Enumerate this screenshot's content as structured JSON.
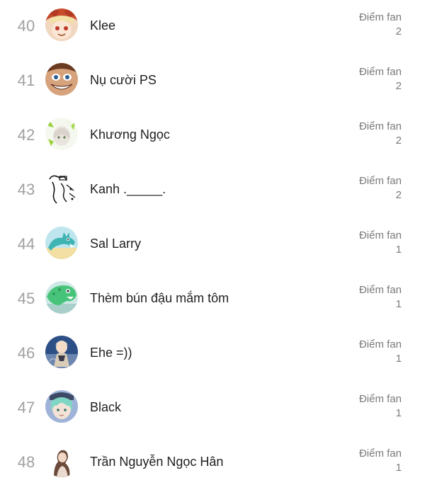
{
  "fans": {
    "score_label": "Điểm fan",
    "items": [
      {
        "rank": "40",
        "name": "Klee",
        "score": "2",
        "avatar": "klee-avatar"
      },
      {
        "rank": "41",
        "name": "Nụ cười PS",
        "score": "2",
        "avatar": "grin-face-avatar"
      },
      {
        "rank": "42",
        "name": "Khương Ngọc",
        "score": "2",
        "avatar": "anime-girl-green-avatar"
      },
      {
        "rank": "43",
        "name": "Kanh ._____.",
        "score": "2",
        "avatar": "sketch-doodle-avatar"
      },
      {
        "rank": "44",
        "name": "Sal Larry",
        "score": "1",
        "avatar": "cartoon-creature-avatar"
      },
      {
        "rank": "45",
        "name": "Thèm bún đậu mắm tôm",
        "score": "1",
        "avatar": "green-dino-avatar"
      },
      {
        "rank": "46",
        "name": "Ehe =))",
        "score": "1",
        "avatar": "anime-character-blue-avatar"
      },
      {
        "rank": "47",
        "name": "Black",
        "score": "1",
        "avatar": "anime-boy-teal-hair-avatar"
      },
      {
        "rank": "48",
        "name": "Trần Nguyễn Ngọc Hân",
        "score": "1",
        "avatar": "girl-photo-avatar"
      }
    ]
  }
}
